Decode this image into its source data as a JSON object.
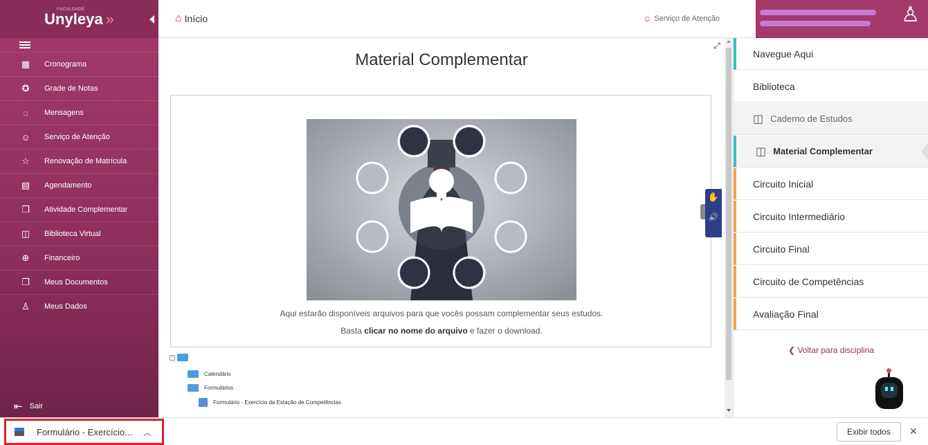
{
  "sidebar": {
    "logo_small": "FACULDADE",
    "logo": "Unyleya",
    "items": [
      {
        "label": "Cronograma",
        "icon": "calendar-icon"
      },
      {
        "label": "Grade de Notas",
        "icon": "award-icon"
      },
      {
        "label": "Mensagens",
        "icon": "chat-icon"
      },
      {
        "label": "Serviço de Atenção",
        "icon": "support-chat-icon"
      },
      {
        "label": "Renovação de Matrícula",
        "icon": "star-icon"
      },
      {
        "label": "Agendamento",
        "icon": "calendar-grid-icon"
      },
      {
        "label": "Atividade Complementar",
        "icon": "documents-icon"
      },
      {
        "label": "Biblioteca Virtual",
        "icon": "book-icon"
      },
      {
        "label": "Financeiro",
        "icon": "money-icon"
      },
      {
        "label": "Meus Documentos",
        "icon": "documents-icon"
      },
      {
        "label": "Meus Dados",
        "icon": "user-icon"
      }
    ],
    "exit": "Sair"
  },
  "topbar": {
    "home": "Início",
    "service": "Serviço de Atenção"
  },
  "main": {
    "title": "Material Complementar",
    "desc1": "Aqui estarão disponíveis arquivos para que vocês possam complementar seus estudos.",
    "desc2_pre": "Basta ",
    "desc2_bold": "clicar no nome do arquivo",
    "desc2_post": " e fazer o download.",
    "tree": {
      "calendario": "Calendário",
      "formularios": "Formulários",
      "file": "Formulário - Exercício da Estação de Competências"
    }
  },
  "rpanel": {
    "items": [
      {
        "label": "Navegue Aqui"
      },
      {
        "label": "Biblioteca"
      },
      {
        "label": "Caderno de Estudos"
      },
      {
        "label": "Material Complementar"
      },
      {
        "label": "Circuito Inicial"
      },
      {
        "label": "Circuito Intermediário"
      },
      {
        "label": "Circuito Final"
      },
      {
        "label": "Circuito de Competências"
      },
      {
        "label": "Avaliação Final"
      }
    ],
    "back": "Voltar para disciplina"
  },
  "downloads": {
    "item": "Formulário - Exercício...",
    "show_all": "Exibir todos"
  },
  "colors": {
    "brand": "#a33a6a",
    "teal": "#3bbfb8",
    "orange": "#f5a34a",
    "highlight": "#e01e2a"
  }
}
